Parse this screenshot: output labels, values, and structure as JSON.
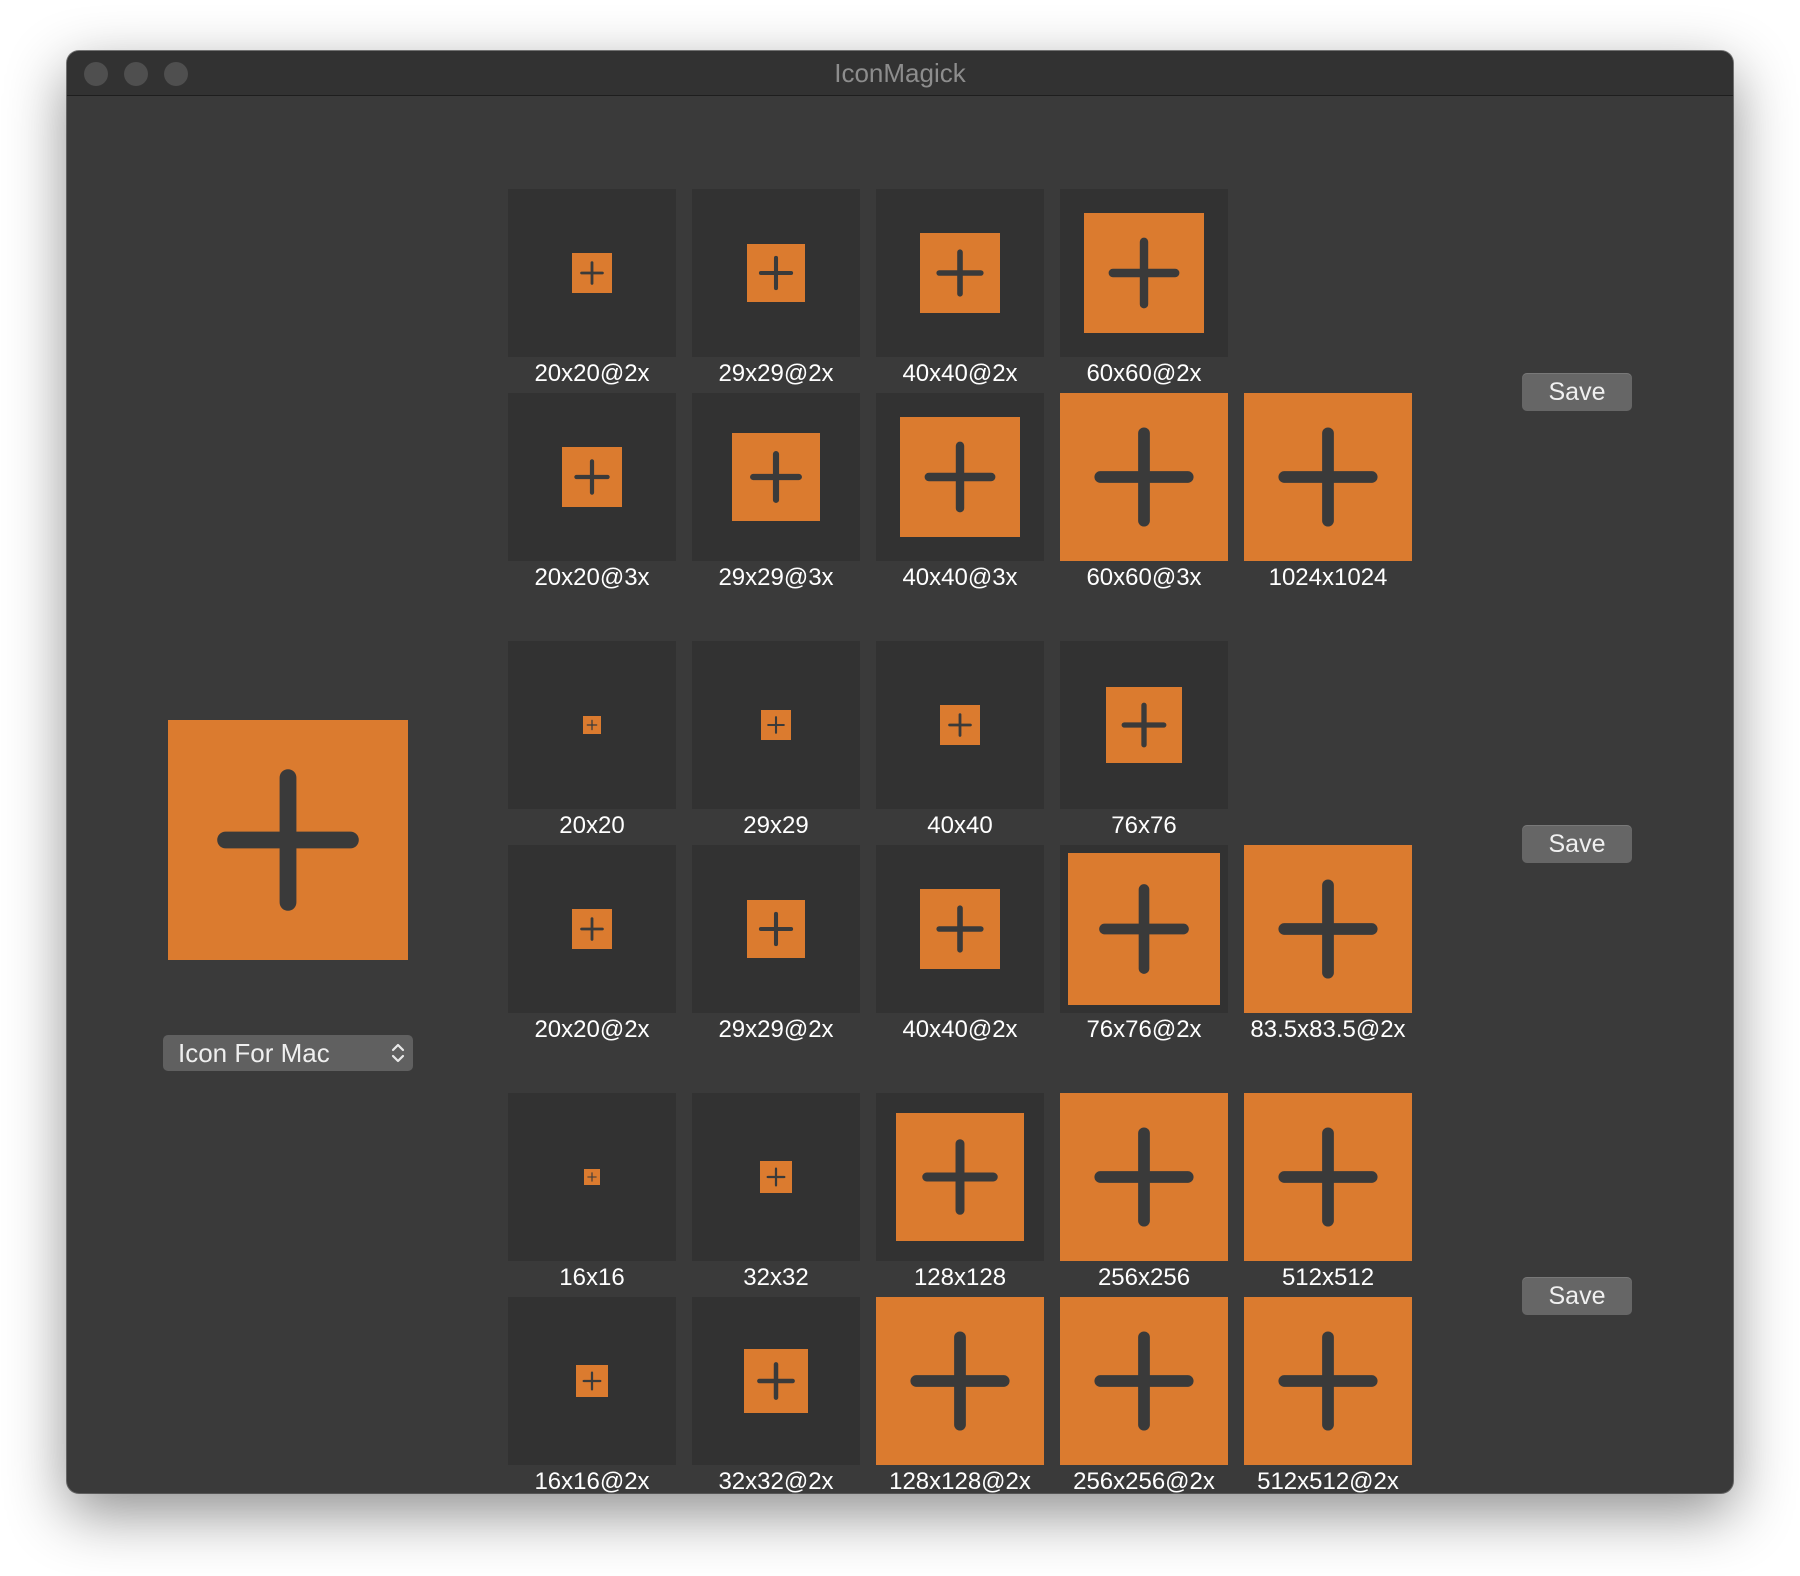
{
  "window": {
    "title": "IconMagick"
  },
  "sidebar": {
    "preview_icon": "plus-icon",
    "icon_type": {
      "selected": "Icon For Mac"
    }
  },
  "colors": {
    "accent": "#db7b2f",
    "tile_bg": "#323232",
    "window_bg": "#3a3a3a"
  },
  "sections": [
    {
      "save_label": "Save",
      "rows": [
        [
          {
            "label": "20x20@2x"
          },
          {
            "label": "29x29@2x"
          },
          {
            "label": "40x40@2x"
          },
          {
            "label": "60x60@2x"
          }
        ],
        [
          {
            "label": "20x20@3x"
          },
          {
            "label": "29x29@3x"
          },
          {
            "label": "40x40@3x"
          },
          {
            "label": "60x60@3x"
          },
          {
            "label": "1024x1024"
          }
        ]
      ]
    },
    {
      "save_label": "Save",
      "rows": [
        [
          {
            "label": "20x20"
          },
          {
            "label": "29x29"
          },
          {
            "label": "40x40"
          },
          {
            "label": "76x76"
          }
        ],
        [
          {
            "label": "20x20@2x"
          },
          {
            "label": "29x29@2x"
          },
          {
            "label": "40x40@2x"
          },
          {
            "label": "76x76@2x"
          },
          {
            "label": "83.5x83.5@2x"
          }
        ]
      ]
    },
    {
      "save_label": "Save",
      "rows": [
        [
          {
            "label": "16x16"
          },
          {
            "label": "32x32"
          },
          {
            "label": "128x128"
          },
          {
            "label": "256x256"
          },
          {
            "label": "512x512"
          }
        ],
        [
          {
            "label": "16x16@2x"
          },
          {
            "label": "32x32@2x"
          },
          {
            "label": "128x128@2x"
          },
          {
            "label": "256x256@2x"
          },
          {
            "label": "512x512@2x"
          }
        ]
      ]
    }
  ]
}
